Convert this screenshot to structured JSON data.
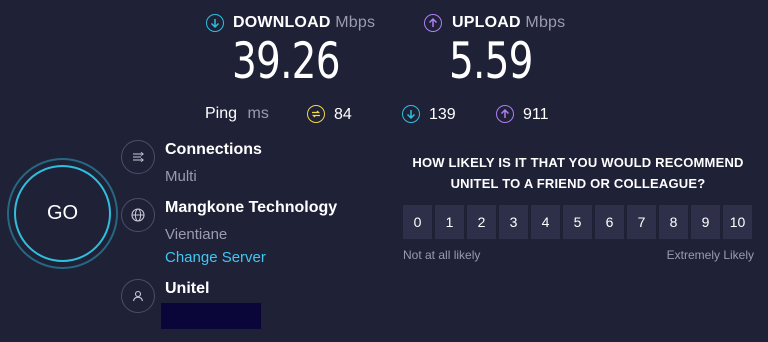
{
  "download": {
    "label": "DOWNLOAD",
    "unit": "Mbps",
    "value": "39.26",
    "icon": "arrow-down-circle-icon",
    "color": "#2fbfde"
  },
  "upload": {
    "label": "UPLOAD",
    "unit": "Mbps",
    "value": "5.59",
    "icon": "arrow-up-circle-icon",
    "color": "#b07ef5"
  },
  "ping": {
    "label": "Ping",
    "unit": "ms",
    "idle": {
      "value": "84",
      "icon": "jitter-icon",
      "color": "#f1d64a"
    },
    "download": {
      "value": "139",
      "icon": "arrow-down-circle-icon",
      "color": "#2fbfde"
    },
    "upload": {
      "value": "911",
      "icon": "arrow-up-circle-icon",
      "color": "#b07ef5"
    }
  },
  "go_button": {
    "label": "GO"
  },
  "connections": {
    "title": "Connections",
    "value": "Multi",
    "icon": "connections-icon"
  },
  "server": {
    "name": "Mangkone Technology",
    "location": "Vientiane",
    "change_link": "Change Server",
    "icon": "globe-icon"
  },
  "provider": {
    "name": "Unitel",
    "icon": "user-icon"
  },
  "survey": {
    "question_line1": "HOW LIKELY IS IT THAT YOU WOULD RECOMMEND",
    "question_line2": "UNITEL TO A FRIEND OR COLLEAGUE?",
    "scale": [
      "0",
      "1",
      "2",
      "3",
      "4",
      "5",
      "6",
      "7",
      "8",
      "9",
      "10"
    ],
    "low_label": "Not at all likely",
    "high_label": "Extremely Likely"
  }
}
